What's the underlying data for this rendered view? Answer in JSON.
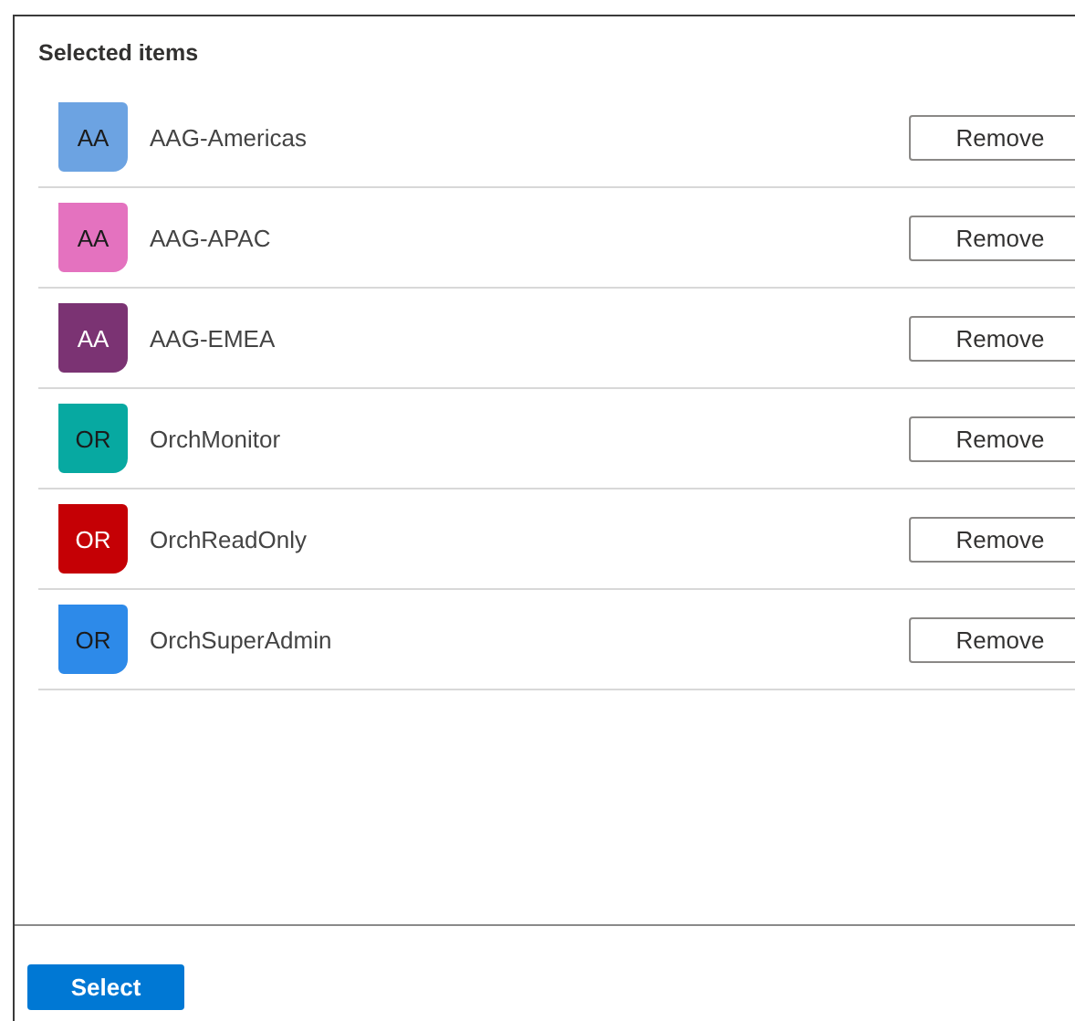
{
  "heading": "Selected items",
  "items": [
    {
      "initials": "AA",
      "name": "AAG-Americas",
      "color": "#6ca3e2",
      "action": "Remove"
    },
    {
      "initials": "AA",
      "name": "AAG-APAC",
      "color": "#e472bf",
      "action": "Remove"
    },
    {
      "initials": "AA",
      "name": "AAG-EMEA",
      "color": "#7b3373",
      "action": "Remove"
    },
    {
      "initials": "OR",
      "name": "OrchMonitor",
      "color": "#07a9a1",
      "action": "Remove"
    },
    {
      "initials": "OR",
      "name": "OrchReadOnly",
      "color": "#c50005",
      "action": "Remove"
    },
    {
      "initials": "OR",
      "name": "OrchSuperAdmin",
      "color": "#2d8ae9",
      "action": "Remove"
    }
  ],
  "primary_button": "Select"
}
